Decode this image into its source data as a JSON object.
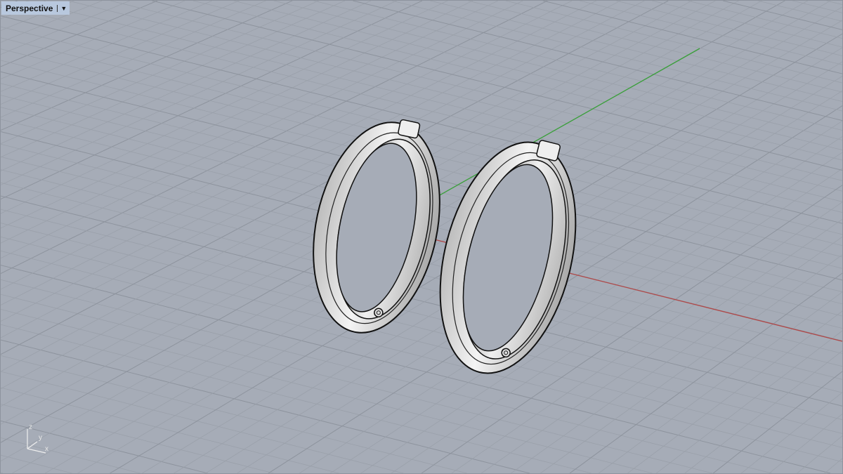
{
  "viewport": {
    "name": "Perspective",
    "menu_icon": "triangle-down-icon",
    "menu_glyph": "▼"
  },
  "axis_widget": {
    "z": "z",
    "y": "y",
    "x": "x"
  },
  "colors": {
    "background": "#a6acb7",
    "grid_minor": "#9aa0aa",
    "grid_major": "#8d939d",
    "x_axis": "#b04040",
    "y_axis": "#3c9a3c",
    "model": "#e2e2e2"
  }
}
